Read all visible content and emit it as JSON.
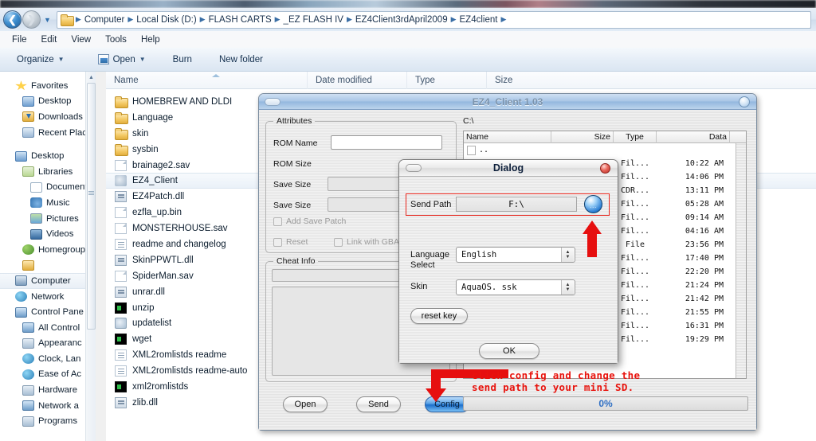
{
  "explorer": {
    "nav": {
      "back_icon": "back-arrow-icon",
      "forward_icon": "forward-arrow-icon",
      "dropdown_icon": "recent-pages-chevron-icon"
    },
    "breadcrumbs": [
      "Computer",
      "Local Disk (D:)",
      "FLASH CARTS",
      "_EZ FLASH IV",
      "EZ4Client3rdApril2009",
      "EZ4client"
    ],
    "menu": [
      "File",
      "Edit",
      "View",
      "Tools",
      "Help"
    ],
    "toolbar": {
      "organize": "Organize",
      "open": "Open",
      "burn": "Burn",
      "new_folder": "New folder"
    },
    "columns": [
      "Name",
      "Date modified",
      "Type",
      "Size"
    ],
    "sidebar": [
      {
        "label": "Favorites",
        "icon": "star-icon",
        "indent": 0,
        "selected": false
      },
      {
        "label": "Desktop",
        "icon": "monitor-icon",
        "indent": 1,
        "selected": false
      },
      {
        "label": "Downloads",
        "icon": "downloads-folder-icon",
        "indent": 1,
        "selected": false
      },
      {
        "label": "Recent Place",
        "icon": "recent-places-icon",
        "indent": 1,
        "selected": false
      },
      {
        "label": "",
        "icon": "spacer",
        "indent": 0,
        "selected": false
      },
      {
        "label": "Desktop",
        "icon": "monitor-icon",
        "indent": 0,
        "selected": false
      },
      {
        "label": "Libraries",
        "icon": "libraries-icon",
        "indent": 1,
        "selected": false
      },
      {
        "label": "Document",
        "icon": "documents-icon",
        "indent": 2,
        "selected": false
      },
      {
        "label": "Music",
        "icon": "music-note-icon",
        "indent": 2,
        "selected": false
      },
      {
        "label": "Pictures",
        "icon": "pictures-icon",
        "indent": 2,
        "selected": false
      },
      {
        "label": "Videos",
        "icon": "videos-icon",
        "indent": 2,
        "selected": false
      },
      {
        "label": "Homegroup",
        "icon": "homegroup-icon",
        "indent": 1,
        "selected": false
      },
      {
        "label": "",
        "icon": "user-folder-icon",
        "indent": 1,
        "selected": false
      },
      {
        "label": "Computer",
        "icon": "computer-icon",
        "indent": 0,
        "selected": true
      },
      {
        "label": "Network",
        "icon": "network-icon",
        "indent": 0,
        "selected": false
      },
      {
        "label": "Control Pane",
        "icon": "control-panel-icon",
        "indent": 0,
        "selected": false
      },
      {
        "label": "All Control",
        "icon": "all-control-items-icon",
        "indent": 1,
        "selected": false
      },
      {
        "label": "Appearanc",
        "icon": "appearance-icon",
        "indent": 1,
        "selected": false
      },
      {
        "label": "Clock, Lan",
        "icon": "clock-language-icon",
        "indent": 1,
        "selected": false
      },
      {
        "label": "Ease of Ac",
        "icon": "ease-of-access-icon",
        "indent": 1,
        "selected": false
      },
      {
        "label": "Hardware ",
        "icon": "hardware-sound-icon",
        "indent": 1,
        "selected": false
      },
      {
        "label": "Network a",
        "icon": "network-internet-icon",
        "indent": 1,
        "selected": false
      },
      {
        "label": "Programs",
        "icon": "programs-icon",
        "indent": 1,
        "selected": false
      }
    ],
    "files": [
      {
        "name": "HOMEBREW AND DLDI",
        "icon": "folder-icon",
        "selected": false
      },
      {
        "name": "Language",
        "icon": "folder-icon",
        "selected": false
      },
      {
        "name": "skin",
        "icon": "folder-icon",
        "selected": false
      },
      {
        "name": "sysbin",
        "icon": "folder-icon",
        "selected": false
      },
      {
        "name": "brainage2.sav",
        "icon": "file-icon",
        "selected": false
      },
      {
        "name": "EZ4_Client",
        "icon": "application-icon",
        "selected": true
      },
      {
        "name": "EZ4Patch.dll",
        "icon": "dll-icon",
        "selected": false
      },
      {
        "name": "ezfla_up.bin",
        "icon": "file-icon",
        "selected": false
      },
      {
        "name": "MONSTERHOUSE.sav",
        "icon": "file-icon",
        "selected": false
      },
      {
        "name": "readme and changelog",
        "icon": "text-icon",
        "selected": false
      },
      {
        "name": "SkinPPWTL.dll",
        "icon": "dll-icon",
        "selected": false
      },
      {
        "name": "SpiderMan.sav",
        "icon": "file-icon",
        "selected": false
      },
      {
        "name": "unrar.dll",
        "icon": "dll-icon",
        "selected": false
      },
      {
        "name": "unzip",
        "icon": "console-exe-icon",
        "selected": false
      },
      {
        "name": "updatelist",
        "icon": "search-doc-icon",
        "selected": false
      },
      {
        "name": "wget",
        "icon": "console-exe-icon",
        "selected": false
      },
      {
        "name": "XML2romlistds readme",
        "icon": "text-icon",
        "selected": false
      },
      {
        "name": "XML2romlistds readme-auto",
        "icon": "text-icon",
        "selected": false
      },
      {
        "name": "xml2romlistds",
        "icon": "console-exe-icon",
        "selected": false
      },
      {
        "name": "zlib.dll",
        "icon": "dll-icon",
        "selected": false
      }
    ]
  },
  "ez4": {
    "title": "EZ4_Client 1.03",
    "attributes": {
      "legend": "Attributes",
      "rom_name_label": "ROM Name",
      "rom_name_value": "",
      "rom_size_label": "ROM Size",
      "save_size_label_1": "Save Size",
      "save_size_value_1": "",
      "save_size_label_2": "Save Size",
      "save_size_value_2": "",
      "add_save_patch": "Add Save Patch",
      "reset": "Reset",
      "link_with_gba": "Link with GBA"
    },
    "cheat_info": {
      "legend": "Cheat Info",
      "field_value": "",
      "list_value": ""
    },
    "path": "C:\\",
    "list_columns": [
      "Name",
      "Size",
      "Type",
      "Data"
    ],
    "rows": [
      {
        "name": "..",
        "size": "",
        "type": "",
        "data": "",
        "icon": "parent-dir-icon"
      },
      {
        "name": "",
        "size": "",
        "type": "Fil...",
        "data": "10:22 AM",
        "icon": "folder-icon"
      },
      {
        "name": "",
        "size": "",
        "type": "Fil...",
        "data": "14:06 PM",
        "icon": "folder-icon"
      },
      {
        "name": "",
        "size": "",
        "type": "CDR...",
        "data": "13:11 PM",
        "icon": "folder-icon"
      },
      {
        "name": "",
        "size": "",
        "type": "Fil...",
        "data": "05:28 AM",
        "icon": "folder-icon"
      },
      {
        "name": "",
        "size": "",
        "type": "Fil...",
        "data": "09:14 AM",
        "icon": "folder-icon"
      },
      {
        "name": "",
        "size": "",
        "type": "Fil...",
        "data": "04:16 AM",
        "icon": "folder-icon"
      },
      {
        "name": "",
        "size": "",
        "type": "File",
        "data": "23:56 PM",
        "icon": "file-icon"
      },
      {
        "name": "",
        "size": "",
        "type": "Fil...",
        "data": "17:40 PM",
        "icon": "file-icon"
      },
      {
        "name": "",
        "size": "",
        "type": "Fil...",
        "data": "22:20 PM",
        "icon": "file-icon"
      },
      {
        "name": "",
        "size": "",
        "type": "Fil...",
        "data": "21:24 PM",
        "icon": "file-icon"
      },
      {
        "name": "",
        "size": "",
        "type": "Fil...",
        "data": "21:42 PM",
        "icon": "file-icon"
      },
      {
        "name": "",
        "size": "",
        "type": "Fil...",
        "data": "21:55 PM",
        "icon": "file-icon"
      },
      {
        "name": "",
        "size": "",
        "type": "Fil...",
        "data": "16:31 PM",
        "icon": "file-icon"
      },
      {
        "name": "",
        "size": "",
        "type": "Fil...",
        "data": "19:29 PM",
        "icon": "file-icon"
      }
    ],
    "buttons": {
      "open": "Open",
      "send": "Send",
      "config": "Config"
    },
    "progress": "0%"
  },
  "dialog": {
    "title": "Dialog",
    "close_icon": "close-icon",
    "send_path_label": "Send Path",
    "send_path_value": "F:\\",
    "browse_label": "...",
    "language_label_line1": "Language",
    "language_label_line2": "Select",
    "language_value": "English",
    "skin_label": "Skin",
    "skin_value": "AquaOS. ssk",
    "reset_key": "reset key",
    "ok": "OK"
  },
  "annotation": {
    "line1": "click config and change the",
    "line2": "send path to your mini SD.",
    "color": "#e8130d"
  }
}
